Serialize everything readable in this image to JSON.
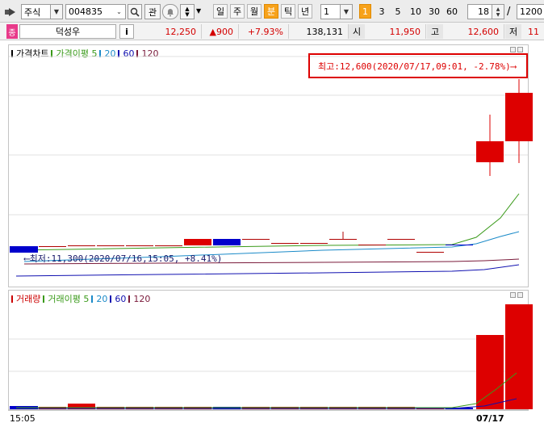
{
  "toolbar": {
    "market_type": "주식",
    "stock_code": "004835",
    "tab_watch": "관",
    "periods": [
      {
        "label": "일",
        "active": false
      },
      {
        "label": "주",
        "active": false
      },
      {
        "label": "월",
        "active": false
      },
      {
        "label": "분",
        "active": true
      },
      {
        "label": "틱",
        "active": false
      },
      {
        "label": "년",
        "active": false
      }
    ],
    "interval_value": "1",
    "interval_highlight": "1",
    "intervals": [
      "3",
      "5",
      "10",
      "30",
      "60"
    ],
    "count_value": "18",
    "slash": "/",
    "total_count": "1200"
  },
  "quote": {
    "flag": "종",
    "stock_name": "덕성우",
    "info_label": "i",
    "price": "12,250",
    "change": "▲900",
    "change_pct": "+7.93%",
    "volume": "138,131",
    "open_label": "시",
    "open": "11,950",
    "high_label": "고",
    "high": "12,600",
    "low_label": "저",
    "low": "11"
  },
  "price_chart": {
    "legend": [
      {
        "text": "가격차트",
        "color": "#000000"
      },
      {
        "text": "가격이평 5",
        "color": "#3a9a1a"
      },
      {
        "text": "20",
        "color": "#1a8ac8"
      },
      {
        "text": "60",
        "color": "#1010b0"
      },
      {
        "text": "120",
        "color": "#7a1a3a"
      }
    ],
    "max_label": "최고:12,600(2020/07/17,09:01, -2.78%)⟶",
    "min_label": "⟵최저:11,300(2020/07/16,15:05, +8.41%)"
  },
  "volume_chart": {
    "legend": [
      {
        "text": "거래량",
        "color": "#cc0000"
      },
      {
        "text": "거래이평 5",
        "color": "#3a9a1a"
      },
      {
        "text": "20",
        "color": "#1a8ac8"
      },
      {
        "text": "60",
        "color": "#1010b0"
      },
      {
        "text": "120",
        "color": "#7a1a3a"
      }
    ]
  },
  "xaxis": {
    "left_label": "15:05",
    "right_label": "07/17"
  },
  "colors": {
    "up": "#dd0000",
    "down": "#0000cc",
    "accent": "#f7a21b"
  },
  "chart_data": {
    "type": "candlestick",
    "price_max": 12600,
    "price_min": 11300,
    "candles": [
      {
        "dir": "down"
      },
      {
        "dir": "flat"
      },
      {
        "dir": "flat"
      },
      {
        "dir": "flat"
      },
      {
        "dir": "flat"
      },
      {
        "dir": "flat"
      },
      {
        "dir": "up"
      },
      {
        "dir": "down"
      },
      {
        "dir": "flat"
      },
      {
        "dir": "flat"
      },
      {
        "dir": "flat"
      },
      {
        "dir": "flat"
      },
      {
        "dir": "flat"
      },
      {
        "dir": "flat"
      },
      {
        "dir": "flat"
      },
      {
        "dir": "down"
      },
      {
        "dir": "up"
      },
      {
        "dir": "up"
      }
    ]
  }
}
